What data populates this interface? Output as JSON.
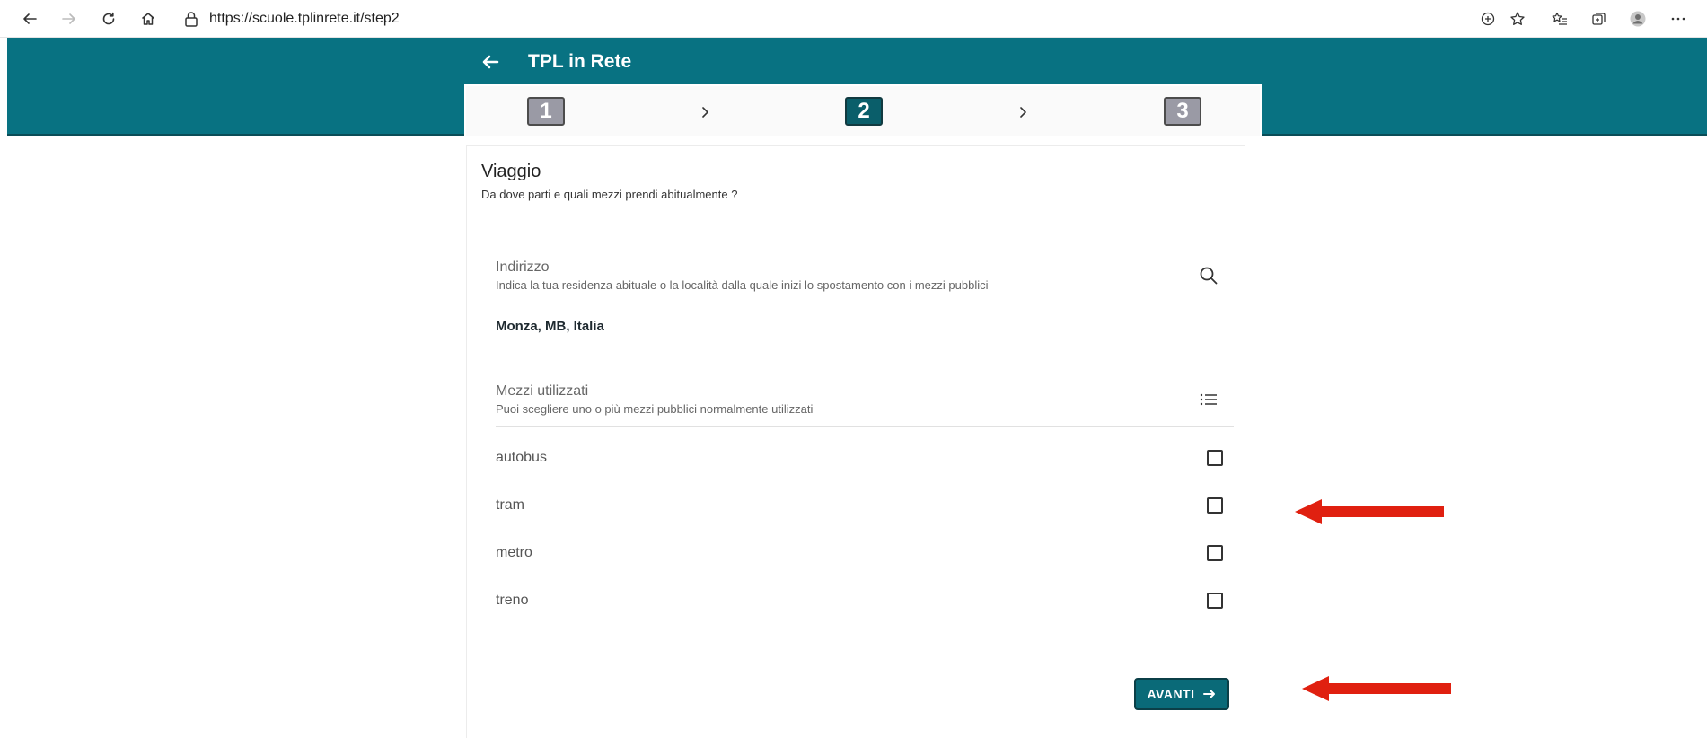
{
  "browser": {
    "url": "https://scuole.tplinrete.it/step2"
  },
  "app": {
    "title": "TPL in Rete",
    "accent_color": "#087282",
    "steps": [
      {
        "label": "1",
        "state": "inactive"
      },
      {
        "label": "2",
        "state": "active"
      },
      {
        "label": "3",
        "state": "inactive"
      }
    ]
  },
  "card": {
    "title": "Viaggio",
    "subtitle": "Da dove parti e quali mezzi prendi abitualmente ?",
    "address_field": {
      "label": "Indirizzo",
      "help": "Indica la tua residenza abituale o la località dalla quale inizi lo spostamento con i mezzi pubblici",
      "icon": "search-icon",
      "value": "Monza, MB, Italia"
    },
    "transport_field": {
      "label": "Mezzi utilizzati",
      "help": "Puoi scegliere uno o più mezzi pubblici normalmente utilizzati",
      "icon": "list-icon",
      "options": [
        {
          "label": "autobus",
          "checked": false
        },
        {
          "label": "tram",
          "checked": false
        },
        {
          "label": "metro",
          "checked": false
        },
        {
          "label": "treno",
          "checked": false
        }
      ]
    },
    "next_button": {
      "label": "AVANTI",
      "icon": "arrow-right-icon"
    }
  },
  "annotations": {
    "arrow_color": "#e02010"
  }
}
